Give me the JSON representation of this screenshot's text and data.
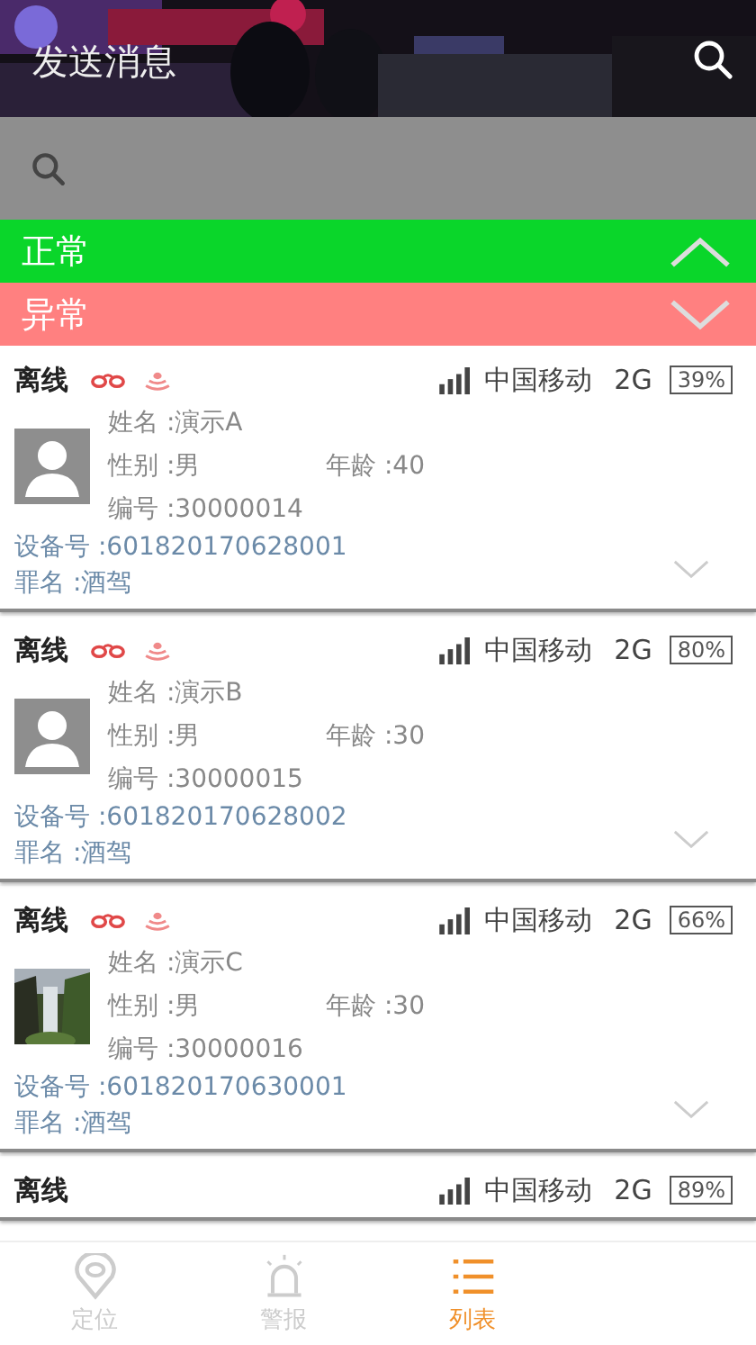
{
  "header": {
    "title": "发送消息"
  },
  "groups": [
    {
      "label": "正常",
      "expanded": true,
      "color": "#0ad62a"
    },
    {
      "label": "异常",
      "expanded": false,
      "color": "#ff8080"
    }
  ],
  "cards": [
    {
      "status": "离线",
      "carrier": "中国移动",
      "network": "2G",
      "battery": "39%",
      "avatar": {
        "kind": "silhouette"
      },
      "name": "姓名 :演示A",
      "gender": "性别 :男",
      "age": "年龄 :40",
      "number": "编号 :30000014",
      "device": "设备号 :601820170628001",
      "crime": "罪名 :酒驾"
    },
    {
      "status": "离线",
      "carrier": "中国移动",
      "network": "2G",
      "battery": "80%",
      "avatar": {
        "kind": "silhouette"
      },
      "name": "姓名 :演示B",
      "gender": "性别 :男",
      "age": "年龄 :30",
      "number": "编号 :30000015",
      "device": "设备号 :601820170628002",
      "crime": "罪名 :酒驾"
    },
    {
      "status": "离线",
      "carrier": "中国移动",
      "network": "2G",
      "battery": "66%",
      "name": "姓名 :演示C",
      "gender": "性别 :男",
      "age": "年龄 :30",
      "number": "编号 :30000016",
      "device": "设备号 :601820170630001",
      "crime": "罪名 :酒驾"
    },
    {
      "status": "离线",
      "carrier": "中国移动",
      "network": "2G",
      "battery": "89%"
    }
  ],
  "nav": [
    {
      "label": "定位",
      "kind": "pin",
      "selected": false
    },
    {
      "label": "警报",
      "kind": "alarm",
      "selected": false
    },
    {
      "label": "列表",
      "kind": "list",
      "selected": true
    }
  ]
}
